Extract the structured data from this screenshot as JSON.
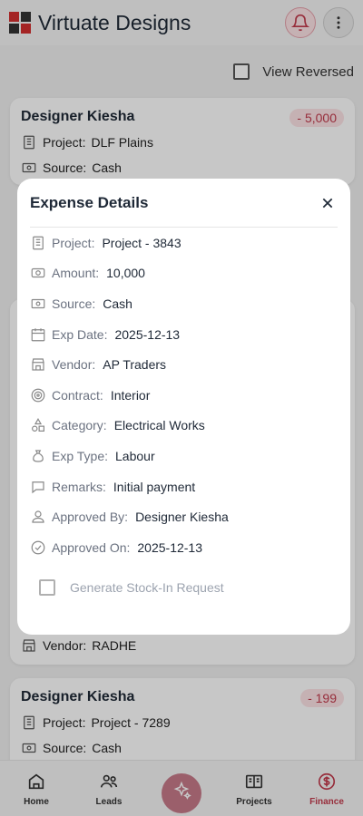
{
  "app": {
    "title": "Virtuate Designs"
  },
  "colors": {
    "accent": "#c23a4c",
    "badge_bg": "#fde3e6",
    "logo_red": "#d32f2f",
    "logo_dark": "#333333"
  },
  "toolbar": {
    "view_reversed_label": "View Reversed"
  },
  "cards": [
    {
      "title": "Designer Kiesha",
      "amount": "- 5,000",
      "project_label": "Project:",
      "project": "DLF Plains",
      "source_label": "Source:",
      "source": "Cash"
    },
    {
      "vendor_label": "Vendor:",
      "vendor": "RADHE"
    },
    {
      "title": "Designer Kiesha",
      "amount": "- 199",
      "project_label": "Project:",
      "project": "Project - 7289",
      "source_label": "Source:",
      "source": "Cash"
    }
  ],
  "modal": {
    "title": "Expense Details",
    "fields": [
      {
        "label": "Project:",
        "value": "Project - 3843",
        "icon": "building-icon"
      },
      {
        "label": "Amount:",
        "value": "10,000",
        "icon": "cash-icon"
      },
      {
        "label": "Source:",
        "value": "Cash",
        "icon": "wallet-icon"
      },
      {
        "label": "Exp Date:",
        "value": "2025-12-13",
        "icon": "calendar-icon"
      },
      {
        "label": "Vendor:",
        "value": "AP Traders",
        "icon": "store-icon"
      },
      {
        "label": "Contract:",
        "value": "Interior",
        "icon": "target-icon"
      },
      {
        "label": "Category:",
        "value": "Electrical Works",
        "icon": "shapes-icon"
      },
      {
        "label": "Exp Type:",
        "value": "Labour",
        "icon": "moneybag-icon"
      },
      {
        "label": "Remarks:",
        "value": "Initial payment",
        "icon": "comment-icon"
      },
      {
        "label": "Approved By:",
        "value": "Designer Kiesha",
        "icon": "user-icon"
      },
      {
        "label": "Approved On:",
        "value": "2025-12-13",
        "icon": "check-circle-icon"
      }
    ],
    "stock_in_label": "Generate Stock-In Request"
  },
  "nav": {
    "home": "Home",
    "leads": "Leads",
    "projects": "Projects",
    "finance": "Finance"
  }
}
